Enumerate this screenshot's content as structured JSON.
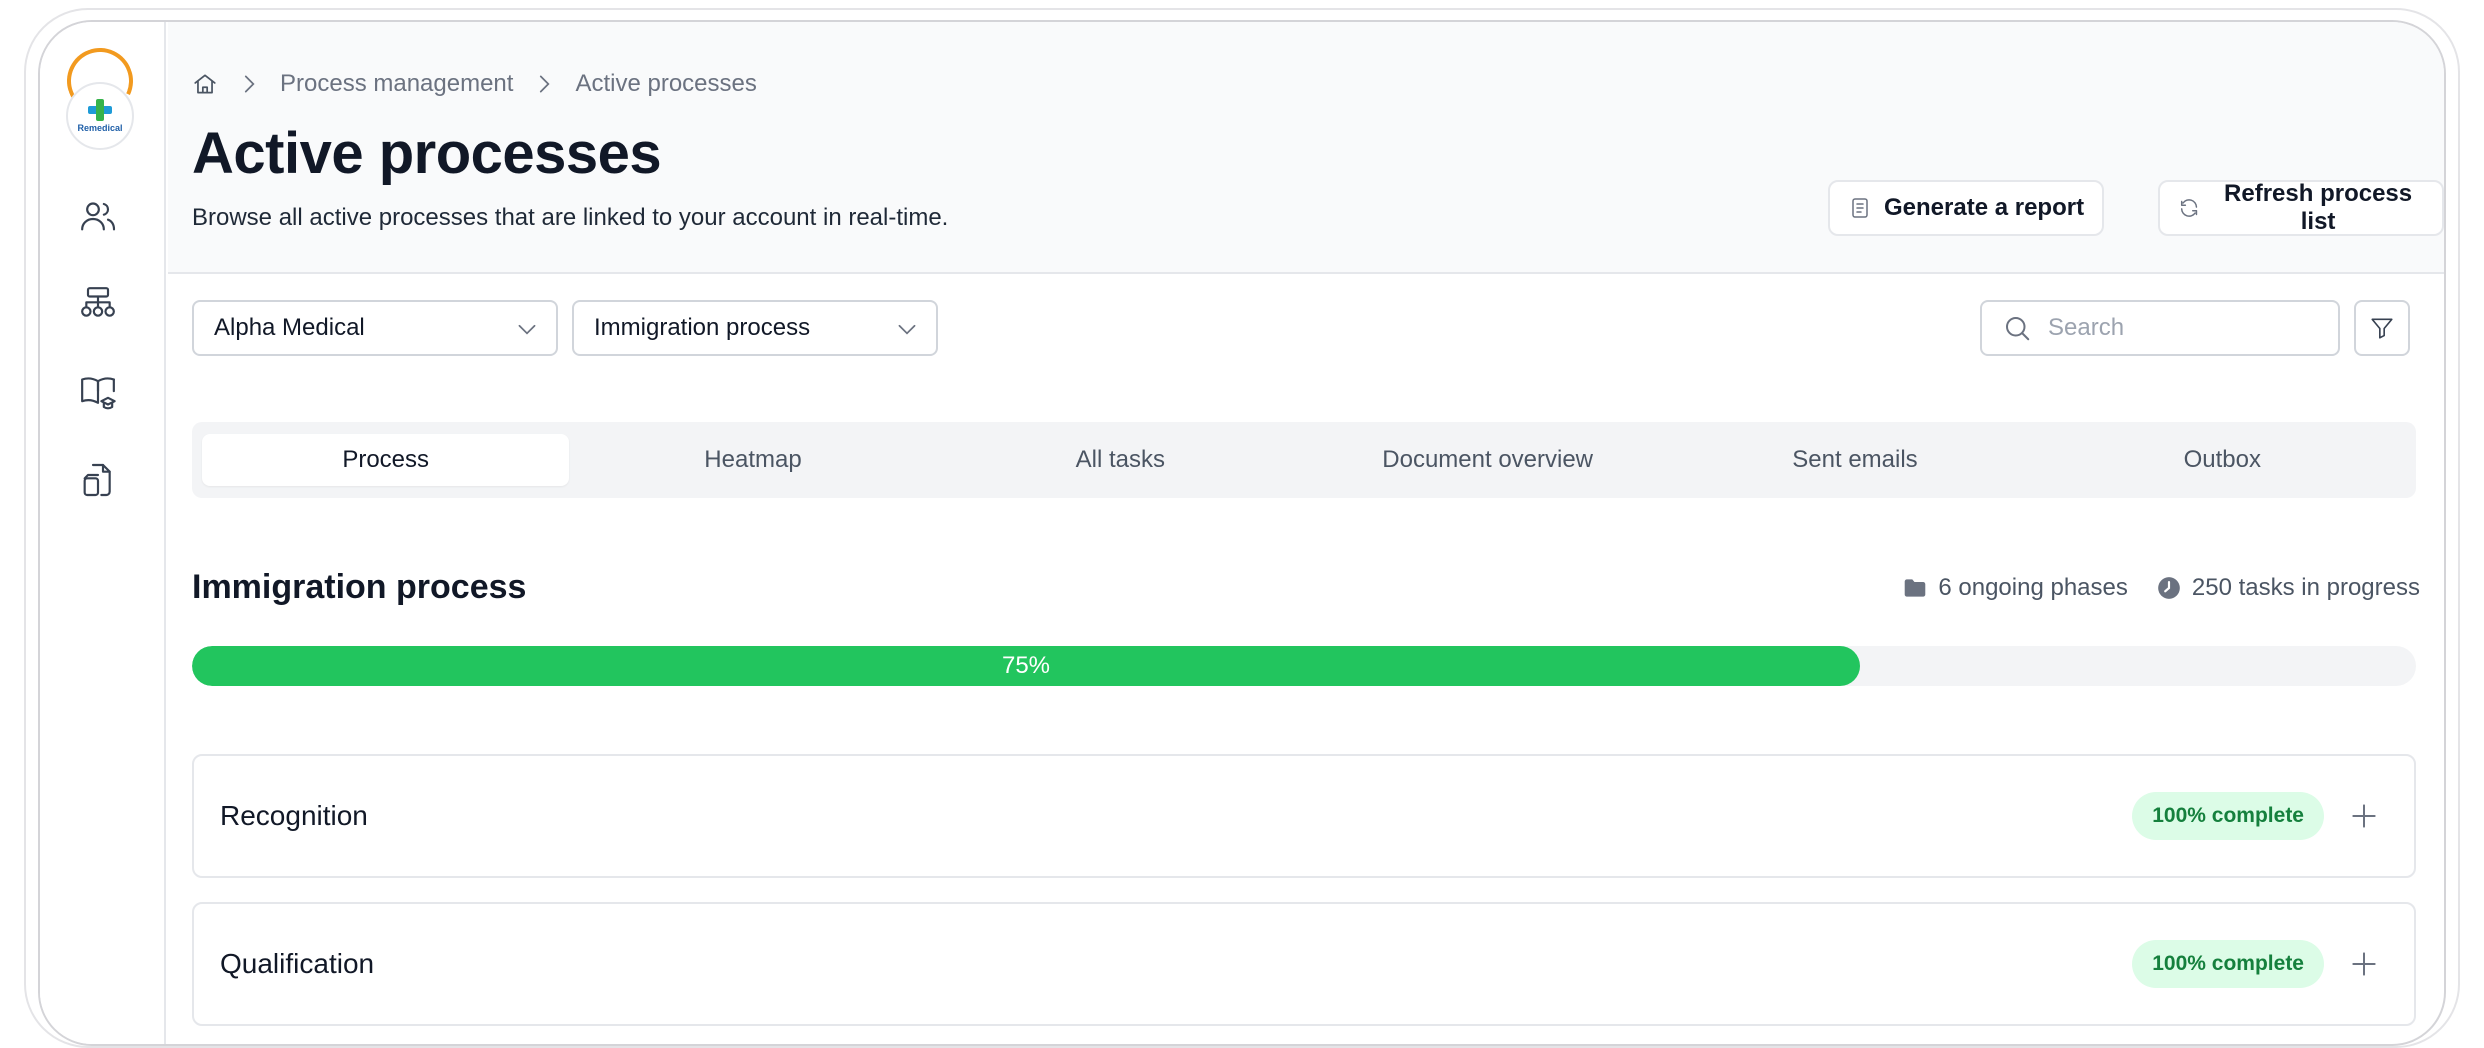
{
  "sidebar": {
    "logo_text": "Remedical",
    "items": [
      {
        "name": "users-icon"
      },
      {
        "name": "sitemap-icon"
      },
      {
        "name": "book-icon"
      },
      {
        "name": "documents-icon"
      }
    ]
  },
  "breadcrumb": {
    "items": [
      "Process management",
      "Active processes"
    ]
  },
  "header": {
    "title": "Active processes",
    "subtitle": "Browse all active processes that are linked to your account in real-time.",
    "generate_report_label": "Generate a report",
    "refresh_label": "Refresh process list"
  },
  "filters": {
    "company": "Alpha Medical",
    "process": "Immigration process",
    "search_placeholder": "Search"
  },
  "tabs": [
    {
      "label": "Process",
      "active": true
    },
    {
      "label": "Heatmap",
      "active": false
    },
    {
      "label": "All tasks",
      "active": false
    },
    {
      "label": "Document overview",
      "active": false
    },
    {
      "label": "Sent emails",
      "active": false
    },
    {
      "label": "Outbox",
      "active": false
    }
  ],
  "process": {
    "title": "Immigration process",
    "phases_text": "6 ongoing phases",
    "tasks_text": "250 tasks in progress",
    "progress": 75,
    "progress_label": "75%"
  },
  "phases": [
    {
      "name": "Recognition",
      "status": "100% complete"
    },
    {
      "name": "Qualification",
      "status": "100% complete"
    }
  ],
  "colors": {
    "progress": "#22c55e",
    "badge_bg": "#dcfce7",
    "badge_text": "#15803d",
    "logo_ring": "#f29a1f"
  }
}
